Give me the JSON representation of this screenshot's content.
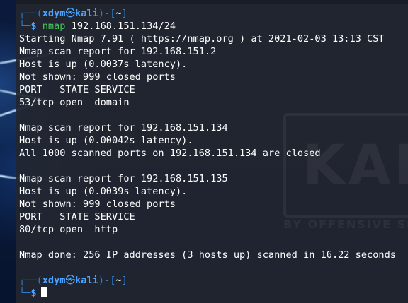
{
  "prompt": {
    "corner_top": "┌──",
    "user": "xdym",
    "at_symbol": "㉿",
    "host": "kali",
    "directory": "~",
    "corner_bottom": "└─",
    "dollar": "$"
  },
  "command": {
    "name": "nmap",
    "args": "192.168.151.134/24"
  },
  "output": {
    "start": "Starting Nmap 7.91 ( https://nmap.org ) at 2021-02-03 13:13 CST",
    "host1": {
      "report": "Nmap scan report for 192.168.151.2",
      "status": "Host is up (0.0037s latency).",
      "not_shown": "Not shown: 999 closed ports",
      "header": "PORT   STATE SERVICE",
      "port": "53/tcp open  domain"
    },
    "host2": {
      "report": "Nmap scan report for 192.168.151.134",
      "status": "Host is up (0.00042s latency).",
      "all_closed": "All 1000 scanned ports on 192.168.151.134 are closed"
    },
    "host3": {
      "report": "Nmap scan report for 192.168.151.135",
      "status": "Host is up (0.0039s latency).",
      "not_shown": "Not shown: 999 closed ports",
      "header": "PORT   STATE SERVICE",
      "port": "80/tcp open  http"
    },
    "done": "Nmap done: 256 IP addresses (3 hosts up) scanned in 16.22 seconds"
  },
  "watermark": {
    "text": "KALI",
    "subtitle": "BY OFFENSIVE SECURITY"
  },
  "colors": {
    "prompt_blue": "#4aa3ff",
    "command_green": "#46c35a",
    "terminal_bg": "#23262f"
  }
}
